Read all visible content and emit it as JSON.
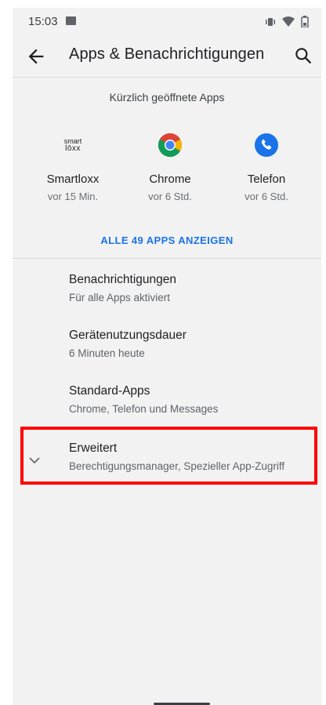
{
  "status_bar": {
    "time": "15:03",
    "left_icons": [
      "image-icon"
    ],
    "right_icons": [
      "vibrate-icon",
      "wifi-icon",
      "battery-icon"
    ]
  },
  "app_bar": {
    "title": "Apps & Benachrichtigungen",
    "back_icon": "arrow-back-icon",
    "search_icon": "search-icon"
  },
  "recent": {
    "heading": "Kürzlich geöffnete Apps",
    "apps": [
      {
        "name": "Smartloxx",
        "meta": "vor 15 Min.",
        "icon": "smartloxx-logo",
        "logo_text_top": "smart",
        "logo_text_bottom": "lōxx"
      },
      {
        "name": "Chrome",
        "meta": "vor 6 Std.",
        "icon": "chrome-icon"
      },
      {
        "name": "Telefon",
        "meta": "vor 6 Std.",
        "icon": "phone-icon"
      }
    ],
    "show_all": "ALLE 49 APPS ANZEIGEN"
  },
  "settings": [
    {
      "title": "Benachrichtigungen",
      "subtitle": "Für alle Apps aktiviert"
    },
    {
      "title": "Gerätenutzungsdauer",
      "subtitle": "6 Minuten heute"
    },
    {
      "title": "Standard-Apps",
      "subtitle": "Chrome, Telefon und Messages"
    },
    {
      "title": "Erweitert",
      "subtitle": "Berechtigungsmanager, Spezieller App-Zugriff",
      "icon": "chevron-down-icon"
    }
  ],
  "colors": {
    "accent": "#1a73e8",
    "highlight": "#ff0000",
    "background": "#f2f2f2"
  }
}
